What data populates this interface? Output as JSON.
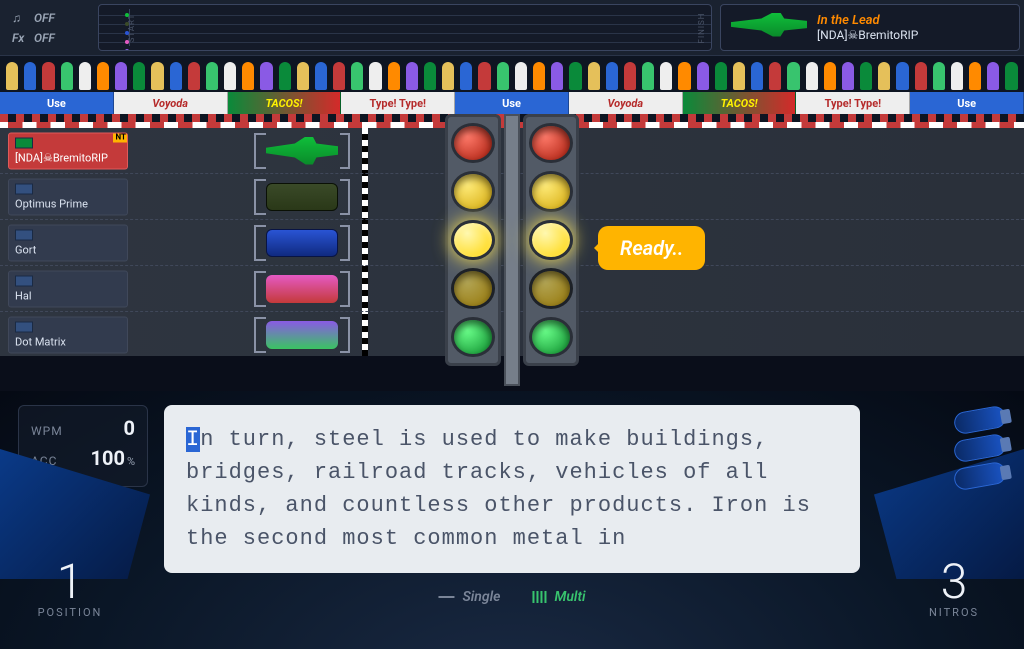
{
  "sound": {
    "music": "OFF",
    "fx": "OFF"
  },
  "minimap": {
    "start_label": "START",
    "finish_label": "FINISH"
  },
  "lead_panel": {
    "title": "In the Lead",
    "name": "[NDA]☠BremitoRIP"
  },
  "ad_boards": [
    {
      "style": "use",
      "label": "Use"
    },
    {
      "style": "voyoda",
      "label": "Voyoda"
    },
    {
      "style": "tacos",
      "label": "TACOS!"
    },
    {
      "style": "typetype",
      "label": "Type! Type!"
    },
    {
      "style": "use",
      "label": "Use"
    },
    {
      "style": "voyoda",
      "label": "Voyoda"
    },
    {
      "style": "tacos",
      "label": "TACOS!"
    },
    {
      "style": "typetype",
      "label": "Type! Type!"
    },
    {
      "style": "use",
      "label": "Use"
    }
  ],
  "players": [
    {
      "name": "[NDA]☠BremitoRIP",
      "me": true,
      "car": "formula",
      "flag_color": "#0a8a3a",
      "nt": true
    },
    {
      "name": "Optimus Prime",
      "me": false,
      "car": "sedan1",
      "flag_color": "#33507f"
    },
    {
      "name": "Gort",
      "me": false,
      "car": "sedan2",
      "flag_color": "#33507f"
    },
    {
      "name": "Hal",
      "me": false,
      "car": "truck1",
      "flag_color": "#33507f"
    },
    {
      "name": "Dot Matrix",
      "me": false,
      "car": "truck2",
      "flag_color": "#33507f"
    }
  ],
  "status_bubble": "Ready..",
  "stats": {
    "wpm_label": "WPM",
    "wpm_value": "0",
    "acc_label": "ACC",
    "acc_value": "100",
    "acc_unit": "%"
  },
  "typing_text": {
    "first_char": "I",
    "rest": "n turn, steel is used to make buildings, bridges, railroad tracks, vehicles of all kinds, and countless other products. Iron is the second most common metal in"
  },
  "position": {
    "value": "1",
    "label": "POSITION"
  },
  "nitros": {
    "count": 3,
    "value": "3",
    "label": "NITROS"
  },
  "modes": {
    "single": "Single",
    "multi": "Multi",
    "active": "multi"
  },
  "colors": {
    "accent_orange": "#ff8a00",
    "accent_yellow": "#ffb400",
    "accent_green": "#38c46e",
    "accent_blue": "#2a66d4",
    "danger_red": "#c43a3a"
  }
}
